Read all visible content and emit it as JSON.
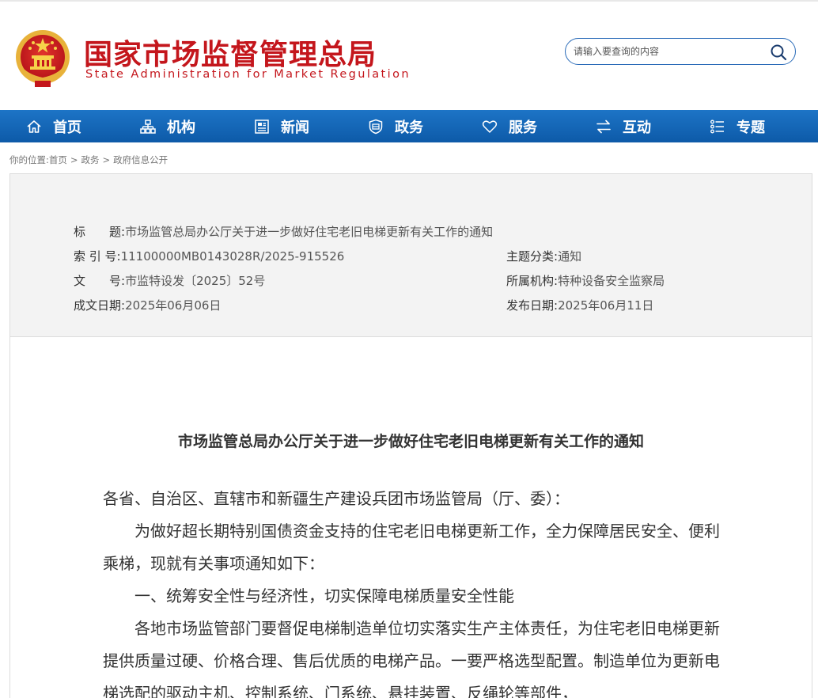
{
  "header": {
    "title_cn": "国家市场监督管理总局",
    "title_en": "State Administration for Market Regulation",
    "search_placeholder": "请输入要查询的内容"
  },
  "nav": {
    "items": [
      {
        "label": "首页",
        "icon": "home-icon"
      },
      {
        "label": "机构",
        "icon": "org-chart-icon"
      },
      {
        "label": "新闻",
        "icon": "news-icon"
      },
      {
        "label": "政务",
        "icon": "government-shield-icon"
      },
      {
        "label": "服务",
        "icon": "heart-icon"
      },
      {
        "label": "互动",
        "icon": "arrows-exchange-icon"
      },
      {
        "label": "专题",
        "icon": "topic-list-icon"
      }
    ]
  },
  "breadcrumb": {
    "prefix": "你的位置:",
    "items": [
      "首页",
      "政务",
      "政府信息公开"
    ],
    "separator": ">"
  },
  "meta": {
    "title_label": "标　　题:",
    "title_value": "市场监管总局办公厅关于进一步做好住宅老旧电梯更新有关工作的通知",
    "index_label": "索 引 号:",
    "index_value": "11100000MB0143028R/2025-915526",
    "category_label": "主题分类:",
    "category_value": "通知",
    "docno_label": "文　　号:",
    "docno_value": "市监特设发〔2025〕52号",
    "org_label": "所属机构:",
    "org_value": "特种设备安全监察局",
    "created_label": "成文日期:",
    "created_value": "2025年06月06日",
    "published_label": "发布日期:",
    "published_value": "2025年06月11日"
  },
  "article": {
    "title": "市场监管总局办公厅关于进一步做好住宅老旧电梯更新有关工作的通知",
    "salutation": "各省、自治区、直辖市和新疆生产建设兵团市场监管局（厅、委）：",
    "para1": "为做好超长期特别国债资金支持的住宅老旧电梯更新工作，全力保障居民安全、便利乘梯，现就有关事项通知如下：",
    "heading1": "一、统筹安全性与经济性，切实保障电梯质量安全性能",
    "para2": "各地市场监管部门要督促电梯制造单位切实落实生产主体责任，为住宅老旧电梯更新提供质量过硬、价格合理、售后优质的电梯产品。一要严格选型配置。制造单位为更新电梯选配的驱动主机、控制系统、门系统、悬挂装置、反绳轮等部件，"
  },
  "colors": {
    "brand_red": "#c4161c",
    "nav_blue": "#1565b8",
    "search_border": "#2a6bb8"
  }
}
